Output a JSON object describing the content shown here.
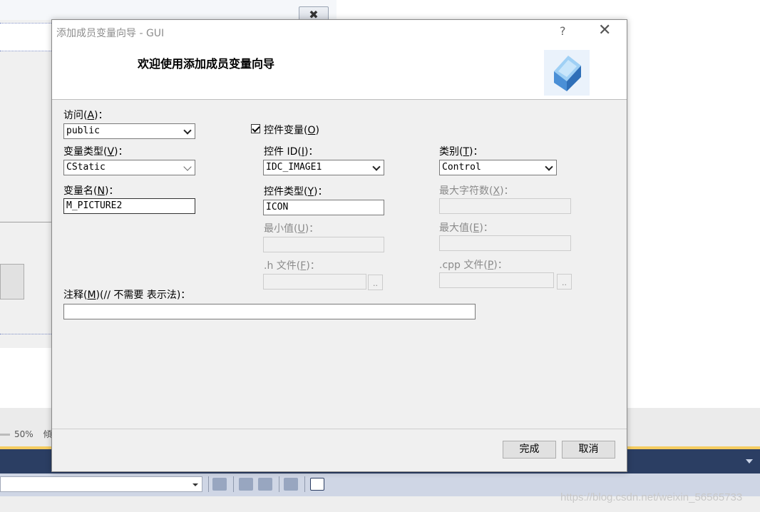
{
  "background": {
    "zoom_label": "50%",
    "zoom_extra": "傾",
    "watermark": "https://blog.csdn.net/weixin_56565733"
  },
  "dialog": {
    "title": "添加成员变量向导 - GUI",
    "help": "?",
    "close": "✕",
    "heading": "欢迎使用添加成员变量向导",
    "access": {
      "label": "访问(",
      "key": "A",
      "suffix": ")：",
      "value": "public"
    },
    "control_variable": {
      "label": "控件变量(",
      "key": "O",
      "suffix": ")",
      "checked": true
    },
    "var_type": {
      "label": "变量类型(",
      "key": "V",
      "suffix": ")：",
      "value": "CStatic"
    },
    "control_id": {
      "label": "控件 ID(",
      "key": "I",
      "suffix": ")：",
      "value": "IDC_IMAGE1"
    },
    "category": {
      "label": "类别(",
      "key": "T",
      "suffix": ")：",
      "value": "Control"
    },
    "var_name": {
      "label": "变量名(",
      "key": "N",
      "suffix": ")：",
      "value": "M_PICTURE2"
    },
    "control_type": {
      "label": "控件类型(",
      "key": "Y",
      "suffix": ")：",
      "value": "ICON"
    },
    "max_chars": {
      "label": "最大字符数(",
      "key": "X",
      "suffix": ")：",
      "value": ""
    },
    "min_value": {
      "label": "最小值(",
      "key": "U",
      "suffix": ")：",
      "value": ""
    },
    "max_value": {
      "label": "最大值(",
      "key": "E",
      "suffix": ")：",
      "value": ""
    },
    "h_file": {
      "label": ".h 文件(",
      "key": "F",
      "suffix": ")：",
      "value": "",
      "browse": ".."
    },
    "cpp_file": {
      "label": ".cpp 文件(",
      "key": "P",
      "suffix": ")：",
      "value": "",
      "browse": ".."
    },
    "comment": {
      "label": "注释(",
      "key": "M",
      "suffix": ")(// 不需要 表示法)：",
      "value": ""
    },
    "buttons": {
      "finish": "完成",
      "cancel": "取消"
    }
  }
}
